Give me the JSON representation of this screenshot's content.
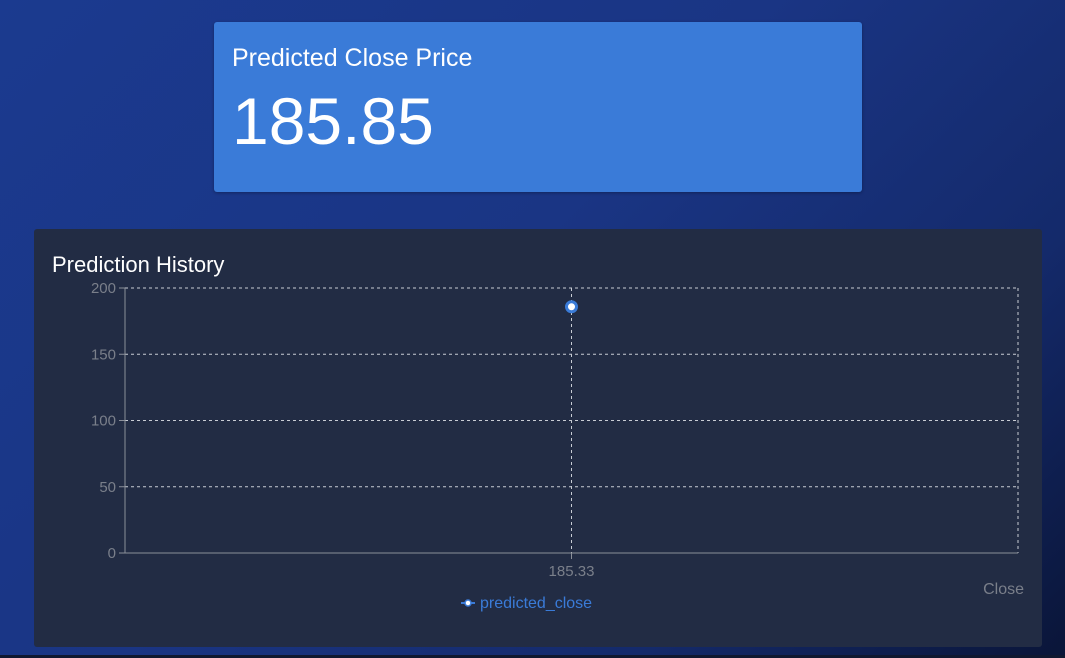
{
  "stat_card": {
    "title": "Predicted Close Price",
    "value": "185.85"
  },
  "chart_card": {
    "title": "Prediction History"
  },
  "chart_data": {
    "type": "line",
    "categories": [
      "185.33"
    ],
    "series": [
      {
        "name": "predicted_close",
        "values": [
          185.85
        ],
        "color": "#3a7bd8"
      }
    ],
    "xlabel": "Close",
    "ylabel": "",
    "ylim": [
      0,
      200
    ],
    "yticks": [
      0,
      50,
      100,
      150,
      200
    ],
    "grid": true,
    "legend": "bottom-center"
  },
  "colors": {
    "accent": "#3a7bd8",
    "card_bg": "#222c44",
    "axis_text": "#7a7f8a"
  }
}
